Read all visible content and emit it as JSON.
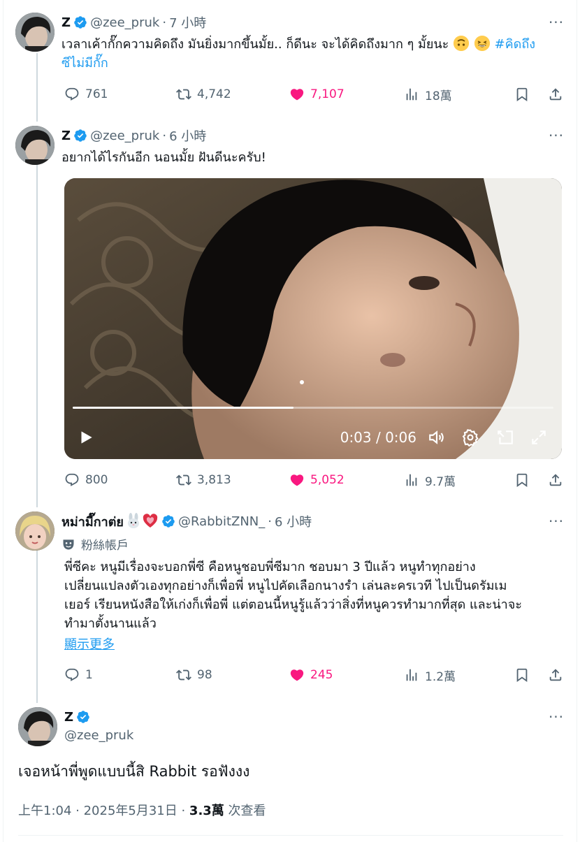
{
  "colors": {
    "accent": "#1d9bf0",
    "like": "#f91880",
    "muted": "#536471",
    "text": "#0f1419"
  },
  "tweet1": {
    "name": "Z",
    "handle": "@zee_pruk",
    "time": "7 小時",
    "text_main": "เวลาเค้ากั๊กความคิดถึง มันยิ่งมากขึ้นมั้ย.. ก็ดีนะ จะได้คิดถึงมาก ๆ มั้ยนะ ",
    "hashtag_part1": "#คิดถึง",
    "hashtag_part2": "ซีไม่มีกั๊ก",
    "emojis": [
      "upside-down-face",
      "grinning-squinting-face"
    ],
    "replies": "761",
    "retweets": "4,742",
    "likes": "7,107",
    "views": "18萬"
  },
  "tweet2": {
    "name": "Z",
    "handle": "@zee_pruk",
    "time": "6 小時",
    "text": "อยากได้ไรกันอีก นอนมั้ย ฝันดีนะครับ!",
    "video_time": "0:03 / 0:06",
    "video_progress": 0.46,
    "replies": "800",
    "retweets": "3,813",
    "likes": "5,052",
    "views": "9.7萬"
  },
  "tweet3": {
    "name": "หม่ามี๊กาต่ย",
    "name_emojis": [
      "rabbit-face",
      "growing-heart"
    ],
    "handle": "@RabbitZNN_",
    "time": "6 小時",
    "badge": "粉絲帳戶",
    "text_lines": [
      "พี่ซีคะ หนูมีเรื่องจะบอกพี่ซี คือหนูชอบพี่ซีมาก ชอบมา 3 ปีแล้ว หนูทำทุกอย่าง",
      "เปลี่ยนแปลงตัวเองทุกอย่างก็เพื่อพี่ หนูไปคัดเลือกนางรำ เล่นละครเวที ไปเป็นดรัมเม",
      "เยอร์ เรียนหนังสือให้เก่งก็เพื่อพี่ แต่ตอนนี้หนูรู้แล้วว่าสิ่งที่หนูควรทำมากที่สุด และน่าจะ",
      "ทำมาตั้งนานแล้ว"
    ],
    "show_more": "顯示更多",
    "replies": "1",
    "retweets": "98",
    "likes": "245",
    "views": "1.2萬"
  },
  "main_tweet": {
    "name": "Z",
    "handle": "@zee_pruk",
    "text": "เจอหน้าพี่พูดแบบนี้สิ Rabbit รอฟังงง",
    "time": "上午1:04 · 2025年5月31日 · ",
    "views_count": "3.3萬",
    "views_label": " 次查看"
  }
}
